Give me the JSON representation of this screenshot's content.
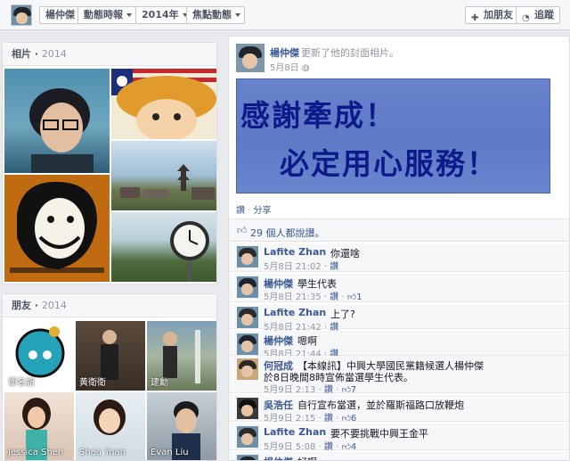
{
  "topbar": {
    "crumbs": [
      "楊仲傑",
      "動態時報",
      "2014年",
      "焦點動態"
    ],
    "add_friend": "加朋友",
    "follow": "追蹤",
    "add_friend_icon": "add-friend-icon",
    "follow_icon": "rss-icon"
  },
  "photos": {
    "title": "相片",
    "year": "2014"
  },
  "friends": {
    "title": "朋友",
    "year": "2014",
    "items": [
      {
        "name": "鄧名誼"
      },
      {
        "name": "黃衛衛"
      },
      {
        "name": "建勳"
      },
      {
        "name": "Jessica Shen"
      },
      {
        "name": "Shea Yuan"
      },
      {
        "name": "Evan Liu"
      }
    ]
  },
  "post": {
    "author": "楊仲傑",
    "action": "更新了他的封面相片。",
    "time": "5月8日",
    "banner_line1": "感謝牽成！",
    "banner_line2": "必定用心服務！",
    "like_link": "讚",
    "share_link": "分享",
    "likes_text": "29 個人都說讚。"
  },
  "comments": [
    {
      "name": "Lafite Zhan",
      "text": "你還啥",
      "time": "5月8日 21:02",
      "like": "讚",
      "count": ""
    },
    {
      "name": "楊仲傑",
      "text": "學生代表",
      "time": "5月8日 21:35",
      "like": "讚",
      "count": "1"
    },
    {
      "name": "Lafite Zhan",
      "text": "上了?",
      "time": "5月8日 21:42",
      "like": "讚",
      "count": ""
    },
    {
      "name": "楊仲傑",
      "text": "嗯啊",
      "time": "5月8日 21:44",
      "like": "讚",
      "count": ""
    },
    {
      "name": "何冠成",
      "text": "【本線訊】中興大學國民黨籍候選人楊仲傑",
      "text2": "於8日晚間8時宣佈當選學生代表。",
      "time": "5月9日 2:13",
      "like": "讚",
      "count": "7"
    },
    {
      "name": "吳浩任",
      "text": "自行宣布當選，並於羅斯福路口放鞭炮",
      "time": "5月9日 2:15",
      "like": "讚",
      "count": "6"
    },
    {
      "name": "Lafite Zhan",
      "text": "要不要挑戰中興王金平",
      "time": "5月9日 5:08",
      "like": "讚",
      "count": "4"
    },
    {
      "name": "楊仲傑",
      "text": "好啊",
      "time": "",
      "like": "",
      "count": ""
    }
  ]
}
